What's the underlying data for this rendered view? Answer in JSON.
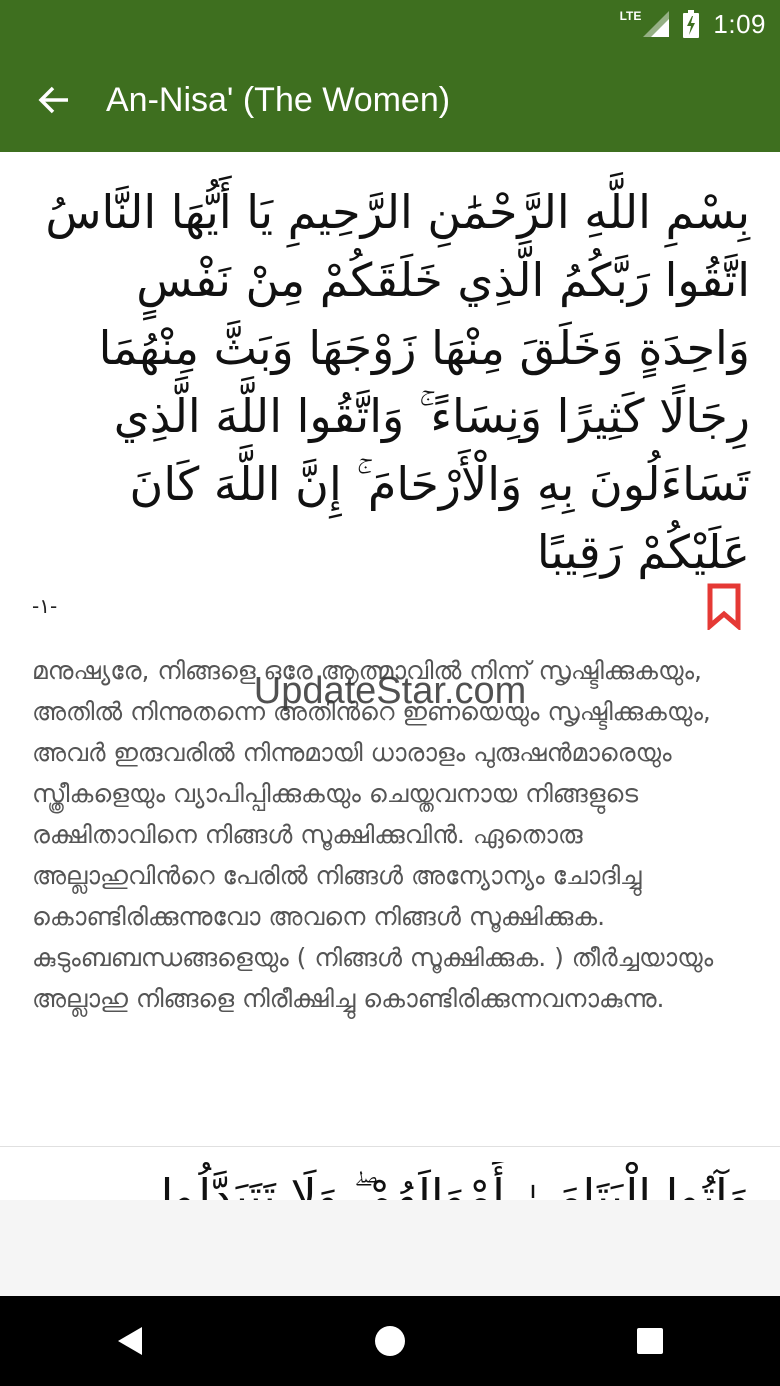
{
  "status_bar": {
    "network": "LTE",
    "time": "1:09"
  },
  "toolbar": {
    "title": "An-Nisa' (The Women)",
    "back_icon": "arrow-left-icon"
  },
  "verse": {
    "arabic": "بِسْمِ اللَّهِ الرَّحْمَٰنِ الرَّحِيمِ يَا أَيُّهَا النَّاسُ اتَّقُوا رَبَّكُمُ الَّذِي خَلَقَكُمْ مِنْ نَفْسٍ وَاحِدَةٍ وَخَلَقَ مِنْهَا زَوْجَهَا وَبَثَّ مِنْهُمَا رِجَالًا كَثِيرًا وَنِسَاءً ۚ وَاتَّقُوا اللَّهَ الَّذِي تَسَاءَلُونَ بِهِ وَالْأَرْحَامَ ۚ إِنَّ اللَّهَ كَانَ عَلَيْكُمْ رَقِيبًا",
    "number": "-١-",
    "translation": "മനുഷ്യരേ, നിങ്ങളെ ഒരേ ആത്മാവില്‍ നിന്ന് സൃഷ്ടിക്കുകയും, അതില്‍ നിന്നുതന്നെ അതിന്‍റെ ഇണയെയും സൃഷ്ടിക്കുകയും, അവര്‍ ഇരുവരില്‍ നിന്നുമായി ധാരാളം പുരുഷന്‍മാരെയും സ്ത്രീകളെയും വ്യാപിപ്പിക്കുകയും ചെയ്തവനായ നിങ്ങളുടെ രക്ഷിതാവിനെ നിങ്ങള്‍ സൂക്ഷിക്കുവിന്‍. ഏതൊരു അല്ലാഹുവിന്‍റെ പേരില്‍ നിങ്ങള്‍ അന്യോന്യം ചോദിച്ചു കൊണ്ടിരിക്കുന്നുവോ അവനെ നിങ്ങള്‍ സൂക്ഷിക്കുക. കുടുംബബന്ധങ്ങളെയും ( നിങ്ങള്‍ സൂക്ഷിക്കുക. ) തീര്‍ച്ചയായും അല്ലാഹു നിങ്ങളെ നിരീക്ഷിച്ചു കൊണ്ടിരിക്കുന്നവനാകുന്നു.",
    "bookmark_icon": "bookmark-icon"
  },
  "next_verse": {
    "arabic": "وَآتُوا الْيَتَامَىٰ أَمْوَالَهُمْ ۖ وَلَا تَتَبَدَّلُوا"
  },
  "watermark": "UpdateStar.com",
  "colors": {
    "appbar": "#3e6f1f",
    "bookmark": "#e53935",
    "navbar": "#000000"
  },
  "nav": {
    "back_icon": "triangle-back-icon",
    "home_icon": "circle-home-icon",
    "recents_icon": "square-recents-icon"
  }
}
